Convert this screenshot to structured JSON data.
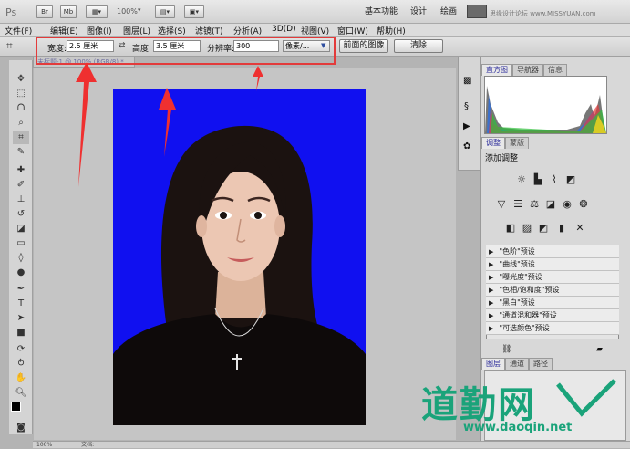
{
  "app": {
    "logo": "Ps",
    "quick_buttons": [
      "Br",
      "Mb"
    ],
    "zoom": "100%",
    "workspaces": [
      "基本功能",
      "设计",
      "绘画"
    ],
    "watermark_top": "思缘设计论坛 www.MISSYUAN.com"
  },
  "menus": [
    "文件(F)",
    "编辑(E)",
    "图像(I)",
    "图层(L)",
    "选择(S)",
    "滤镜(T)",
    "分析(A)",
    "3D(D)",
    "视图(V)",
    "窗口(W)",
    "帮助(H)"
  ],
  "options": {
    "width_label": "宽度:",
    "width_value": "2.5 厘米",
    "height_label": "高度:",
    "height_value": "3.5 厘米",
    "resolution_label": "分辨率:",
    "resolution_value": "300",
    "unit_value": "像素/...",
    "front_image_button": "前面的图像",
    "clear_button": "清除"
  },
  "document": {
    "tab_title": "未标题-1 @ 100% (RGB/8) *"
  },
  "panels": {
    "histogram_tabs": [
      "直方图",
      "导航器",
      "信息"
    ],
    "adjust_tabs": [
      "调整",
      "蒙版"
    ],
    "adjust_title": "添加调整",
    "presets": [
      "\"色阶\"预设",
      "\"曲线\"预设",
      "\"曝光度\"预设",
      "\"色相/饱和度\"预设",
      "\"黑白\"预设",
      "\"通道混和器\"预设",
      "\"可选颜色\"预设"
    ],
    "layer_tabs": [
      "图层",
      "通道",
      "路径"
    ]
  },
  "watermark": {
    "brand": "道勤网",
    "url": "www.daoqin.net"
  },
  "status": {
    "zoom": "100%",
    "doc": "文档:"
  },
  "colors": {
    "photo_background": "#1010f0",
    "annotation_red": "#e33b3b",
    "watermark_green": "#1aa37a"
  }
}
